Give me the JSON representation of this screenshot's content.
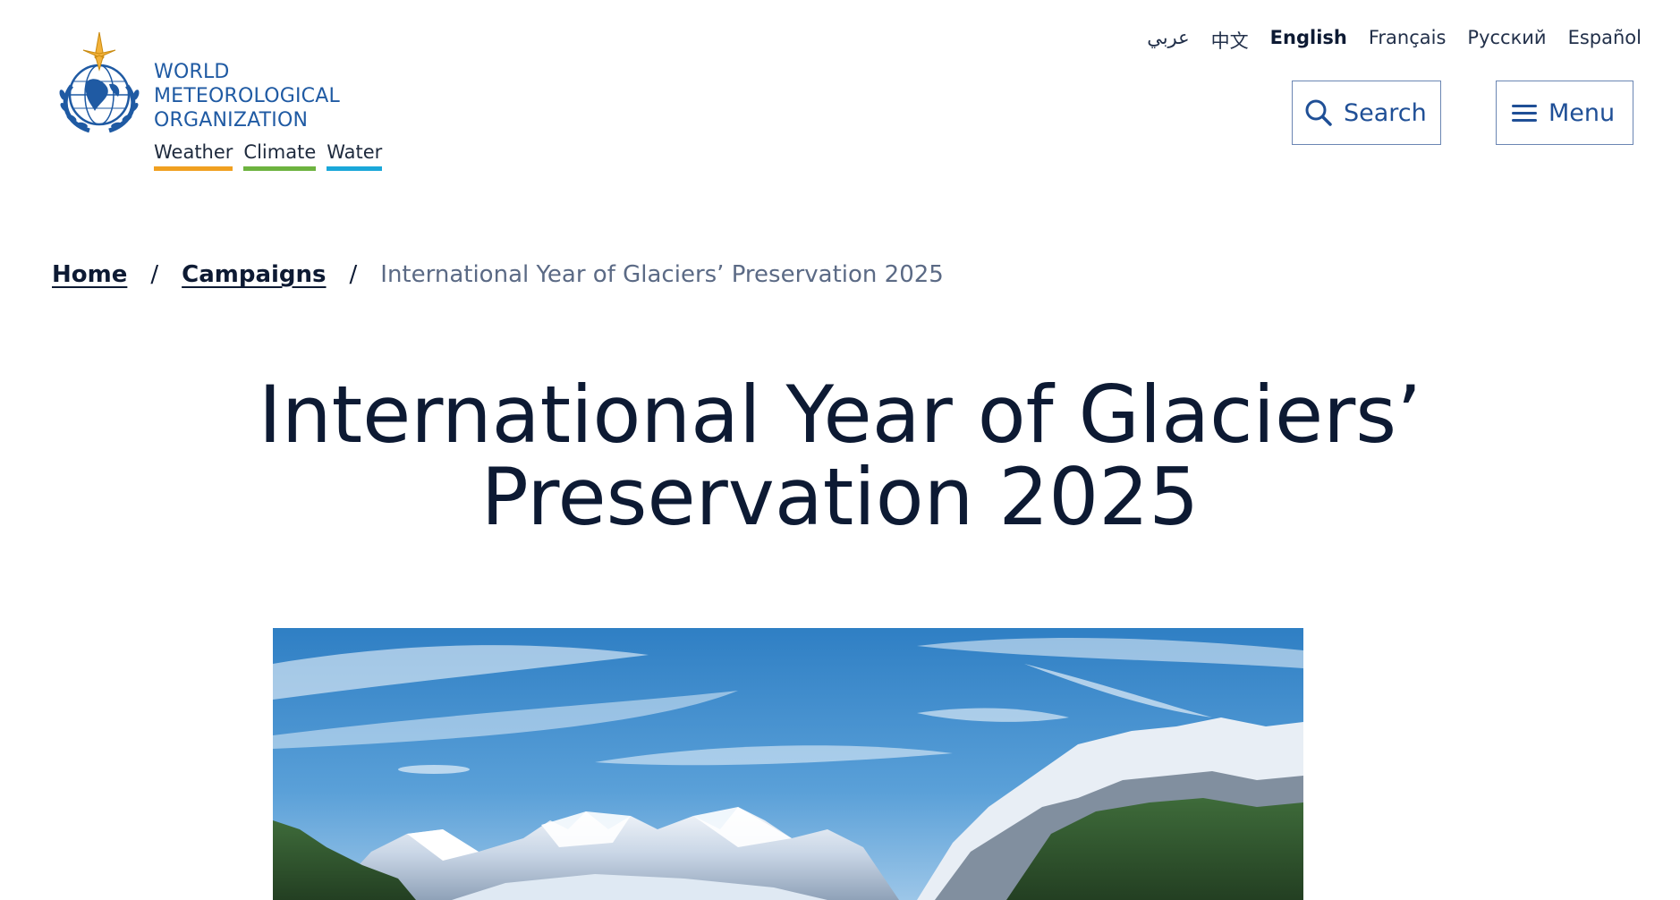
{
  "org": {
    "name_lines": [
      "WORLD",
      "METEOROLOGICAL",
      "ORGANIZATION"
    ],
    "tagline": [
      {
        "label": "Weather",
        "color": "#f0a020"
      },
      {
        "label": "Climate",
        "color": "#6db33f"
      },
      {
        "label": "Water",
        "color": "#1aa7d9"
      }
    ]
  },
  "languages": [
    {
      "label": "عربي",
      "active": false
    },
    {
      "label": "中文",
      "active": false
    },
    {
      "label": "English",
      "active": true
    },
    {
      "label": "Français",
      "active": false
    },
    {
      "label": "Русский",
      "active": false
    },
    {
      "label": "Español",
      "active": false
    }
  ],
  "header": {
    "search_label": "Search",
    "menu_label": "Menu"
  },
  "breadcrumb": {
    "items": [
      "Home",
      "Campaigns"
    ],
    "separator": "/",
    "current": "International Year of Glaciers’ Preservation 2025"
  },
  "page": {
    "title_line1": "International Year of Glaciers’",
    "title_line2": "Preservation 2025"
  },
  "icons": {
    "logo": "wmo-emblem-icon",
    "search": "search-icon",
    "menu": "hamburger-icon"
  },
  "colors": {
    "brand_blue": "#1f5aa3",
    "title": "#0d1a33"
  }
}
